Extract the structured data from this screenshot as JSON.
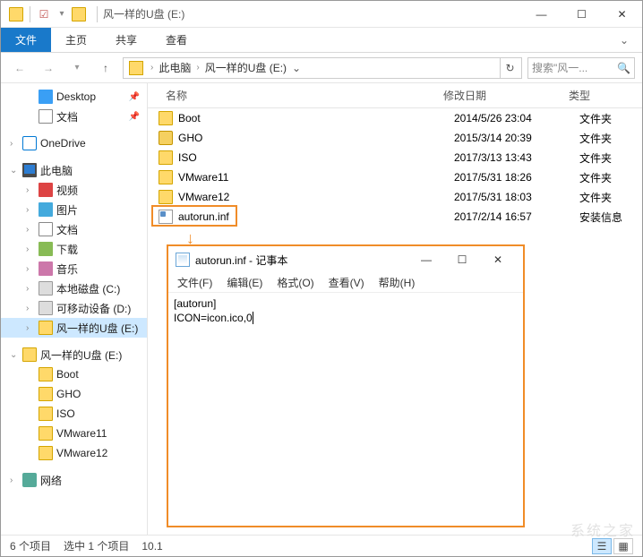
{
  "titlebar": {
    "title": "风一样的U盘 (E:)"
  },
  "ribbon": {
    "file": "文件",
    "home": "主页",
    "share": "共享",
    "view": "查看"
  },
  "address": {
    "root": "此电脑",
    "location": "风一样的U盘 (E:)",
    "search_placeholder": "搜索\"风一..."
  },
  "nav": {
    "desktop": "Desktop",
    "docs": "文档",
    "onedrive": "OneDrive",
    "pc": "此电脑",
    "video": "视频",
    "pictures": "图片",
    "docs2": "文档",
    "downloads": "下载",
    "music": "音乐",
    "cdisk": "本地磁盘 (C:)",
    "ddisk": "可移动设备 (D:)",
    "edisk": "风一样的U盘 (E:)",
    "edisk2": "风一样的U盘 (E:)",
    "boot": "Boot",
    "gho": "GHO",
    "iso": "ISO",
    "vm11": "VMware11",
    "vm12": "VMware12",
    "network": "网络"
  },
  "columns": {
    "name": "名称",
    "date": "修改日期",
    "type": "类型"
  },
  "files": [
    {
      "name": "Boot",
      "date": "2014/5/26 23:04",
      "type": "文件夹",
      "icon": "folder"
    },
    {
      "name": "GHO",
      "date": "2015/3/14 20:39",
      "type": "文件夹",
      "icon": "gho"
    },
    {
      "name": "ISO",
      "date": "2017/3/13 13:43",
      "type": "文件夹",
      "icon": "folder"
    },
    {
      "name": "VMware11",
      "date": "2017/5/31 18:26",
      "type": "文件夹",
      "icon": "folder"
    },
    {
      "name": "VMware12",
      "date": "2017/5/31 18:03",
      "type": "文件夹",
      "icon": "folder"
    },
    {
      "name": "autorun.inf",
      "date": "2017/2/14 16:57",
      "type": "安装信息",
      "icon": "inf",
      "highlighted": true
    }
  ],
  "status": {
    "count": "6 个项目",
    "selected": "选中 1 个项目",
    "size": "10.1"
  },
  "notepad": {
    "title": "autorun.inf - 记事本",
    "menu": {
      "file": "文件(F)",
      "edit": "编辑(E)",
      "format": "格式(O)",
      "view": "查看(V)",
      "help": "帮助(H)"
    },
    "line1": "[autorun]",
    "line2": "ICON=icon.ico,0"
  },
  "watermark": "系统之家"
}
